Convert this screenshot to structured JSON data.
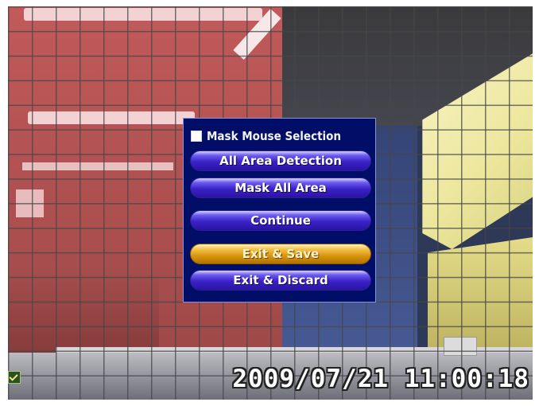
{
  "menu": {
    "mask_mouse_selection_label": "Mask Mouse Selection",
    "mask_mouse_selection_checked": false,
    "buttons": [
      {
        "label": "All Area Detection",
        "state": "normal"
      },
      {
        "label": "Mask All Area",
        "state": "normal"
      },
      {
        "label": "Continue",
        "state": "normal"
      },
      {
        "label": "Exit & Save",
        "state": "highlighted"
      },
      {
        "label": "Exit & Discard",
        "state": "normal"
      }
    ]
  },
  "osd": {
    "timestamp": "2009/07/21 11:00:18"
  },
  "colors": {
    "menu_background": "#000e68",
    "button_blue": "#3a22c8",
    "button_highlight_orange": "#d9950c",
    "mask_overlay_red": "#c25a5a"
  }
}
